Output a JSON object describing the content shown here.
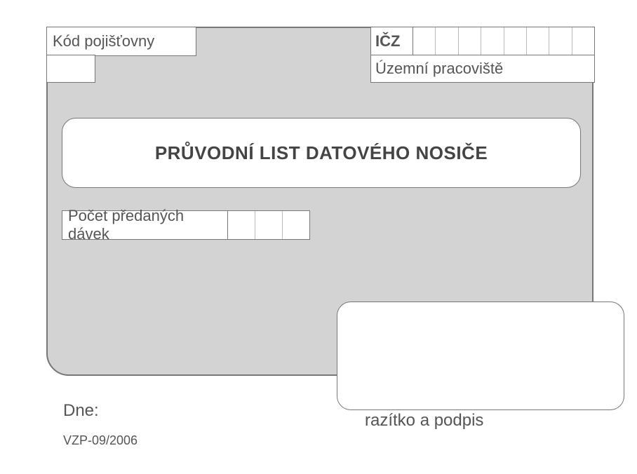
{
  "labels": {
    "kod_pojistovny": "Kód pojišťovny",
    "icz": "IČZ",
    "uzemni_pracoviste": "Územní pracoviště",
    "pocet_davek": "Počet předaných dávek",
    "dne": "Dne:",
    "stamp_caption": "razítko a podpis"
  },
  "title": "PRŮVODNÍ LIST DATOVÉHO NOSIČE",
  "form_id": "VZP-09/2006",
  "field_cells": {
    "icz_count": 8,
    "pocet_count": 3
  }
}
